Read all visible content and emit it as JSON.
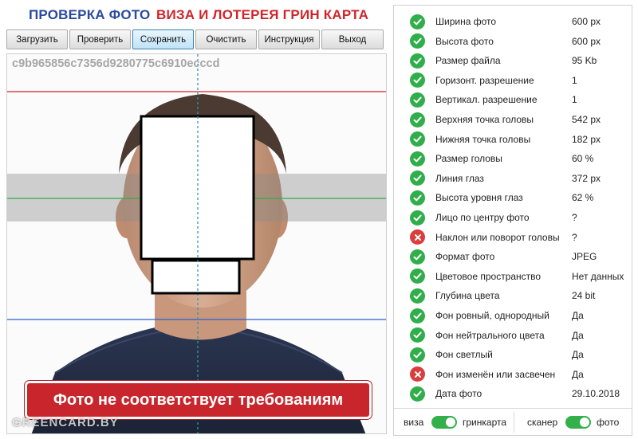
{
  "header": {
    "title_left": "ПРОВЕРКА ФОТО",
    "title_right": "ВИЗА И ЛОТЕРЕЯ ГРИН КАРТА"
  },
  "toolbar": {
    "buttons": [
      "Загрузить",
      "Проверить",
      "Сохранить",
      "Очистить",
      "Инструкция",
      "Выход"
    ]
  },
  "photo": {
    "hash": "c9b965856c7356d9280775c6910ecccd",
    "warning": "Фото не соответствует требованиям",
    "watermark": "GREENCARD.BY"
  },
  "checks": [
    {
      "status": "ok",
      "label": "Ширина фото",
      "value": "600 px"
    },
    {
      "status": "ok",
      "label": "Высота фото",
      "value": "600 px"
    },
    {
      "status": "ok",
      "label": "Размер файла",
      "value": "95 Kb"
    },
    {
      "status": "ok",
      "label": "Горизонт. разрешение",
      "value": "1"
    },
    {
      "status": "ok",
      "label": "Вертикал. разрешение",
      "value": "1"
    },
    {
      "status": "ok",
      "label": "Верхняя точка головы",
      "value": "542 px"
    },
    {
      "status": "ok",
      "label": "Нижняя точка головы",
      "value": "182 px"
    },
    {
      "status": "ok",
      "label": "Размер головы",
      "value": "60 %"
    },
    {
      "status": "ok",
      "label": "Линия глаз",
      "value": "372 px"
    },
    {
      "status": "ok",
      "label": "Высота уровня глаз",
      "value": "62 %"
    },
    {
      "status": "ok",
      "label": "Лицо по центру фото",
      "value": "?"
    },
    {
      "status": "bad",
      "label": "Наклон или поворот головы",
      "value": "?"
    },
    {
      "status": "ok",
      "label": "Формат фото",
      "value": "JPEG"
    },
    {
      "status": "ok",
      "label": "Цветовое пространство",
      "value": "Нет данных"
    },
    {
      "status": "ok",
      "label": "Глубина цвета",
      "value": "24 bit"
    },
    {
      "status": "ok",
      "label": "Фон ровный, однородный",
      "value": "Да"
    },
    {
      "status": "ok",
      "label": "Фон нейтрального цвета",
      "value": "Да"
    },
    {
      "status": "ok",
      "label": "Фон светлый",
      "value": "Да"
    },
    {
      "status": "bad",
      "label": "Фон изменён или засвечен",
      "value": "Да"
    },
    {
      "status": "ok",
      "label": "Дата фото",
      "value": "29.10.2018"
    }
  ],
  "toggles": {
    "left": {
      "off_label": "виза",
      "on_label": "гринкарта",
      "state": "on"
    },
    "right": {
      "off_label": "сканер",
      "on_label": "фото",
      "state": "on"
    }
  },
  "colors": {
    "title_blue": "#2b4a9e",
    "title_red": "#d0242b",
    "ok_green": "#2fae4a",
    "error_red": "#db3c3c",
    "warning_red": "#c8262c",
    "toggle_green": "#33b04a"
  }
}
